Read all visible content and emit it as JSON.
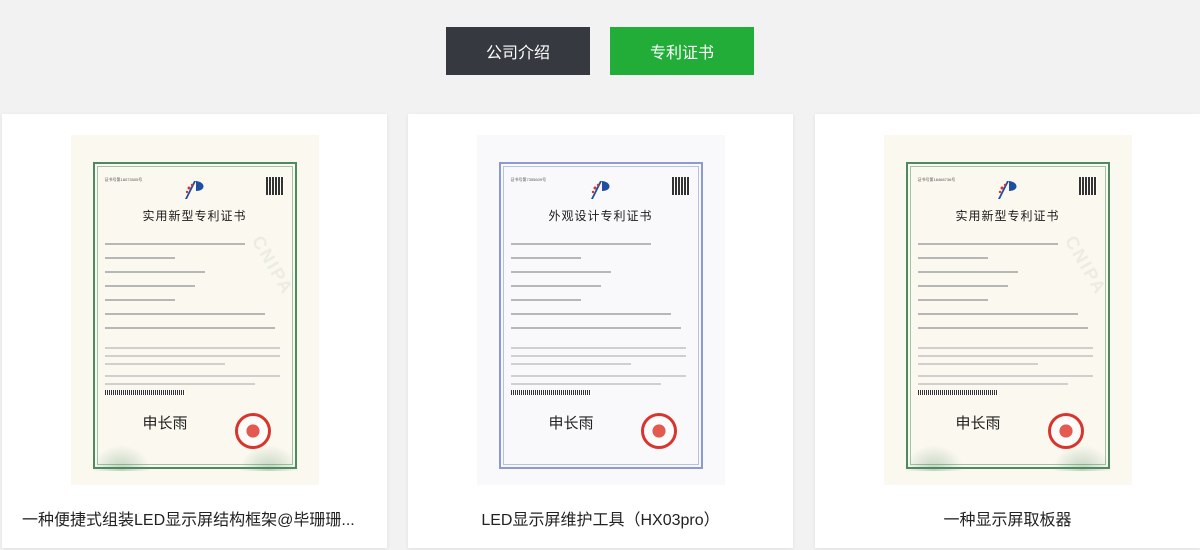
{
  "tabs": [
    {
      "label": "公司介绍",
      "active": false
    },
    {
      "label": "专利证书",
      "active": true
    }
  ],
  "colors": {
    "tab_dark": "#363a40",
    "tab_active": "#22ad38",
    "seal_red": "#d7352d"
  },
  "cards": [
    {
      "caption": "一种便捷式组装LED显示屏结构框架@毕珊珊...",
      "cert_title": "实用新型专利证书",
      "frame": "green"
    },
    {
      "caption": "LED显示屏维护工具（HX03pro）",
      "cert_title": "外观设计专利证书",
      "frame": "blue"
    },
    {
      "caption": "一种显示屏取板器",
      "cert_title": "实用新型专利证书",
      "frame": "green"
    }
  ],
  "cert_common": {
    "signature": "申长雨",
    "watermark": "CNIPA"
  }
}
